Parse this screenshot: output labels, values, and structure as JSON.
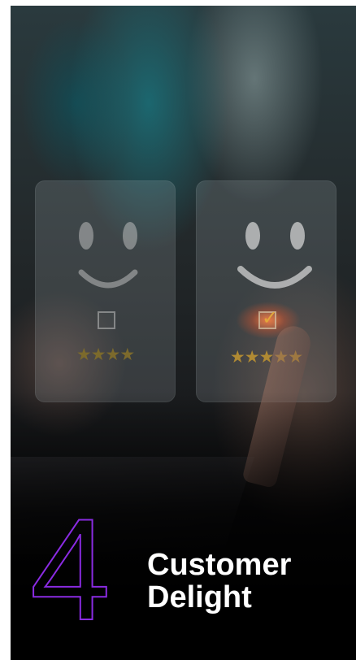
{
  "number": "4",
  "title": {
    "line1": "Customer",
    "line2": "Delight"
  },
  "rating_cards": [
    {
      "rating": "★★★★",
      "stars": 4,
      "checked": false
    },
    {
      "rating": "★★★★★",
      "stars": 5,
      "checked": true,
      "checkmark": "✓"
    }
  ],
  "colors": {
    "number_outline": "#8a2be2",
    "title_text": "#ffffff",
    "star": "#b08a33"
  }
}
